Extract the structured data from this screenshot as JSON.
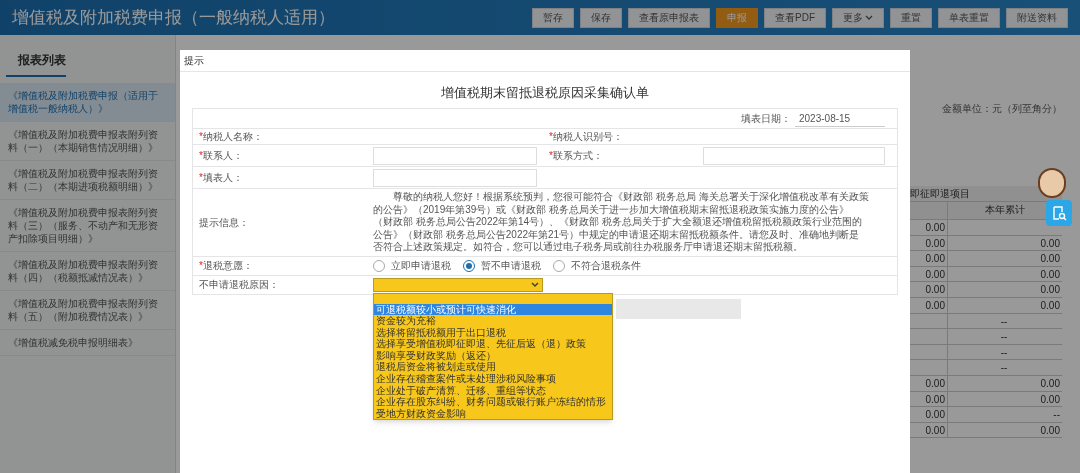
{
  "header": {
    "title": "增值税及附加税费申报（一般纳税人适用）",
    "buttons": [
      {
        "label": "暂存",
        "selected": false,
        "kind": "plain"
      },
      {
        "label": "保存",
        "selected": false,
        "kind": "plain"
      },
      {
        "label": "查看原申报表",
        "selected": false,
        "kind": "plain"
      },
      {
        "label": "申报",
        "selected": true,
        "kind": "plain"
      },
      {
        "label": "查看PDF",
        "selected": false,
        "kind": "plain"
      },
      {
        "label": "更多",
        "selected": false,
        "kind": "menu"
      },
      {
        "label": "重置",
        "selected": false,
        "kind": "plain"
      },
      {
        "label": "单表重置",
        "selected": false,
        "kind": "plain"
      },
      {
        "label": "附送资料",
        "selected": false,
        "kind": "plain"
      }
    ]
  },
  "sidebar": {
    "title": "报表列表",
    "items": [
      {
        "label": "《增值税及附加税费申报（适用于增值税一般纳税人）》",
        "selected": true
      },
      {
        "label": "《增值税及附加税费申报表附列资料（一）（本期销售情况明细）》",
        "selected": false
      },
      {
        "label": "《增值税及附加税费申报表附列资料（二）（本期进项税额明细）》",
        "selected": false
      },
      {
        "label": "《增值税及附加税费申报表附列资料（三）（服务、不动产和无形资产扣除项目明细）》",
        "selected": false
      },
      {
        "label": "《增值税及附加税费申报表附列资料（四）（税额抵减情况表）》",
        "selected": false
      },
      {
        "label": "《增值税及附加税费申报表附列资料（五）（附加税费情况表）》",
        "selected": false
      },
      {
        "label": "《增值税减免税申报明细表》",
        "selected": false
      }
    ]
  },
  "background_table": {
    "unit": "金额单位：元（列至角分）",
    "group_header": "即征即退项目",
    "column_header": "本年累计",
    "rows": [
      {
        "col_1": "0.00"
      },
      {
        "col_1": "0.00",
        "col_2": "0.00"
      },
      {
        "col_1": "0.00",
        "col_2": "0.00"
      },
      {
        "col_1": "0.00",
        "col_2": "0.00"
      },
      {
        "col_1": "0.00",
        "col_2": "0.00"
      },
      {
        "col_1": "0.00",
        "col_2": "0.00"
      },
      {
        "col_2": "--"
      },
      {
        "col_2": "--"
      },
      {
        "col_2": "--"
      },
      {
        "col_2": "--"
      },
      {
        "col_1": "0.00",
        "col_2": "0.00"
      },
      {
        "col_1": "0.00",
        "col_2": "0.00"
      },
      {
        "col_1": "0.00",
        "col_2": "--"
      },
      {
        "col_1": "0.00",
        "col_2": "0.00"
      }
    ]
  },
  "dialog": {
    "title": "提示",
    "form_title": "增值税期末留抵退税原因采集确认单",
    "date": {
      "label": "填表日期：",
      "value": "2023-08-15"
    },
    "taxpayer_name": {
      "label": "纳税人名称：",
      "required_mark": "*"
    },
    "taxpayer_id": {
      "label": "纳税人识别号：",
      "required_mark": "*"
    },
    "contact_person": {
      "label": "联系人：",
      "required_mark": "*"
    },
    "contact_info": {
      "label": "联系方式：",
      "required_mark": "*"
    },
    "filler": {
      "label": "填表人：",
      "required_mark": "*"
    },
    "hint": {
      "label": "提示信息：",
      "text": "尊敬的纳税人您好！根据系统预判，您很可能符合《财政部 税务总局 海关总署关于深化增值税改革有关政策的公告》（2019年第39号）或《财政部 税务总局关于进一步加大增值税期末留抵退税政策实施力度的公告》（财政部 税务总局公告2022年第14号）、《财政部 税务总局关于扩大全额退还增值税留抵税额政策行业范围的公告》（财政部 税务总局公告2022年第21号）中规定的申请退还期末留抵税额条件。请您及时、准确地判断是否符合上述政策规定。如符合，您可以通过电子税务局或前往办税服务厅申请退还期末留抵税额。"
    },
    "refund_intent": {
      "label": "退税意愿：",
      "required_mark": "*",
      "options": [
        {
          "label": "立即申请退税",
          "selected": false
        },
        {
          "label": "暂不申请退税",
          "selected": true
        },
        {
          "label": "不符合退税条件",
          "selected": false
        }
      ]
    },
    "reason": {
      "label": "不申请退税原因：",
      "expanded": true,
      "options": [
        {
          "label": "可退税额较小或预计可快速消化",
          "selected": true
        },
        {
          "label": "资金较为充裕",
          "selected": false
        },
        {
          "label": "选择将留抵税额用于出口退税",
          "selected": false
        },
        {
          "label": "选择享受增值税即征即退、先征后返（退）政策",
          "selected": false
        },
        {
          "label": "影响享受财政奖励（返还）",
          "selected": false
        },
        {
          "label": "退税后资金将被划走或使用",
          "selected": false
        },
        {
          "label": "企业存在稽查案件或未处理涉税风险事项",
          "selected": false
        },
        {
          "label": "企业处于破产清算、迁移、重组等状态",
          "selected": false
        },
        {
          "label": "企业存在股东纠纷、财务问题或银行账户冻结的情形",
          "selected": false
        },
        {
          "label": "受地方财政资金影响",
          "selected": false
        }
      ]
    }
  }
}
